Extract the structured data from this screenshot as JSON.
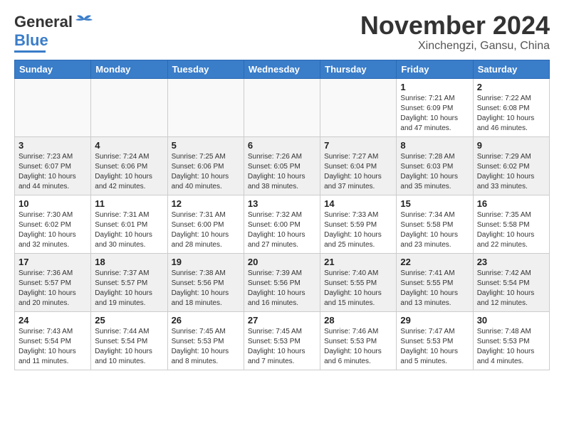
{
  "header": {
    "logo_line1": "General",
    "logo_line2": "Blue",
    "month": "November 2024",
    "location": "Xinchengzi, Gansu, China"
  },
  "weekdays": [
    "Sunday",
    "Monday",
    "Tuesday",
    "Wednesday",
    "Thursday",
    "Friday",
    "Saturday"
  ],
  "weeks": [
    [
      {
        "day": "",
        "info": ""
      },
      {
        "day": "",
        "info": ""
      },
      {
        "day": "",
        "info": ""
      },
      {
        "day": "",
        "info": ""
      },
      {
        "day": "",
        "info": ""
      },
      {
        "day": "1",
        "info": "Sunrise: 7:21 AM\nSunset: 6:09 PM\nDaylight: 10 hours\nand 47 minutes."
      },
      {
        "day": "2",
        "info": "Sunrise: 7:22 AM\nSunset: 6:08 PM\nDaylight: 10 hours\nand 46 minutes."
      }
    ],
    [
      {
        "day": "3",
        "info": "Sunrise: 7:23 AM\nSunset: 6:07 PM\nDaylight: 10 hours\nand 44 minutes."
      },
      {
        "day": "4",
        "info": "Sunrise: 7:24 AM\nSunset: 6:06 PM\nDaylight: 10 hours\nand 42 minutes."
      },
      {
        "day": "5",
        "info": "Sunrise: 7:25 AM\nSunset: 6:06 PM\nDaylight: 10 hours\nand 40 minutes."
      },
      {
        "day": "6",
        "info": "Sunrise: 7:26 AM\nSunset: 6:05 PM\nDaylight: 10 hours\nand 38 minutes."
      },
      {
        "day": "7",
        "info": "Sunrise: 7:27 AM\nSunset: 6:04 PM\nDaylight: 10 hours\nand 37 minutes."
      },
      {
        "day": "8",
        "info": "Sunrise: 7:28 AM\nSunset: 6:03 PM\nDaylight: 10 hours\nand 35 minutes."
      },
      {
        "day": "9",
        "info": "Sunrise: 7:29 AM\nSunset: 6:02 PM\nDaylight: 10 hours\nand 33 minutes."
      }
    ],
    [
      {
        "day": "10",
        "info": "Sunrise: 7:30 AM\nSunset: 6:02 PM\nDaylight: 10 hours\nand 32 minutes."
      },
      {
        "day": "11",
        "info": "Sunrise: 7:31 AM\nSunset: 6:01 PM\nDaylight: 10 hours\nand 30 minutes."
      },
      {
        "day": "12",
        "info": "Sunrise: 7:31 AM\nSunset: 6:00 PM\nDaylight: 10 hours\nand 28 minutes."
      },
      {
        "day": "13",
        "info": "Sunrise: 7:32 AM\nSunset: 6:00 PM\nDaylight: 10 hours\nand 27 minutes."
      },
      {
        "day": "14",
        "info": "Sunrise: 7:33 AM\nSunset: 5:59 PM\nDaylight: 10 hours\nand 25 minutes."
      },
      {
        "day": "15",
        "info": "Sunrise: 7:34 AM\nSunset: 5:58 PM\nDaylight: 10 hours\nand 23 minutes."
      },
      {
        "day": "16",
        "info": "Sunrise: 7:35 AM\nSunset: 5:58 PM\nDaylight: 10 hours\nand 22 minutes."
      }
    ],
    [
      {
        "day": "17",
        "info": "Sunrise: 7:36 AM\nSunset: 5:57 PM\nDaylight: 10 hours\nand 20 minutes."
      },
      {
        "day": "18",
        "info": "Sunrise: 7:37 AM\nSunset: 5:57 PM\nDaylight: 10 hours\nand 19 minutes."
      },
      {
        "day": "19",
        "info": "Sunrise: 7:38 AM\nSunset: 5:56 PM\nDaylight: 10 hours\nand 18 minutes."
      },
      {
        "day": "20",
        "info": "Sunrise: 7:39 AM\nSunset: 5:56 PM\nDaylight: 10 hours\nand 16 minutes."
      },
      {
        "day": "21",
        "info": "Sunrise: 7:40 AM\nSunset: 5:55 PM\nDaylight: 10 hours\nand 15 minutes."
      },
      {
        "day": "22",
        "info": "Sunrise: 7:41 AM\nSunset: 5:55 PM\nDaylight: 10 hours\nand 13 minutes."
      },
      {
        "day": "23",
        "info": "Sunrise: 7:42 AM\nSunset: 5:54 PM\nDaylight: 10 hours\nand 12 minutes."
      }
    ],
    [
      {
        "day": "24",
        "info": "Sunrise: 7:43 AM\nSunset: 5:54 PM\nDaylight: 10 hours\nand 11 minutes."
      },
      {
        "day": "25",
        "info": "Sunrise: 7:44 AM\nSunset: 5:54 PM\nDaylight: 10 hours\nand 10 minutes."
      },
      {
        "day": "26",
        "info": "Sunrise: 7:45 AM\nSunset: 5:53 PM\nDaylight: 10 hours\nand 8 minutes."
      },
      {
        "day": "27",
        "info": "Sunrise: 7:45 AM\nSunset: 5:53 PM\nDaylight: 10 hours\nand 7 minutes."
      },
      {
        "day": "28",
        "info": "Sunrise: 7:46 AM\nSunset: 5:53 PM\nDaylight: 10 hours\nand 6 minutes."
      },
      {
        "day": "29",
        "info": "Sunrise: 7:47 AM\nSunset: 5:53 PM\nDaylight: 10 hours\nand 5 minutes."
      },
      {
        "day": "30",
        "info": "Sunrise: 7:48 AM\nSunset: 5:53 PM\nDaylight: 10 hours\nand 4 minutes."
      }
    ]
  ]
}
